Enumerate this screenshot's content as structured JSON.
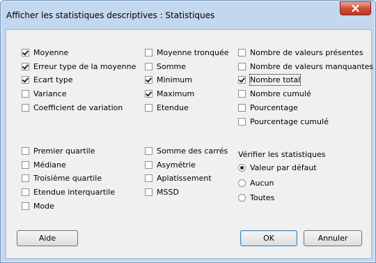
{
  "window": {
    "title": "Afficher les statistiques descriptives : Statistiques"
  },
  "icons": {
    "close": "close-x-icon"
  },
  "col1": [
    {
      "label": "Moyenne",
      "checked": true
    },
    {
      "label": "Erreur type de la moyenne",
      "checked": true
    },
    {
      "label": "Ecart type",
      "checked": true
    },
    {
      "label": "Variance",
      "checked": false
    },
    {
      "label": "Coefficient de variation",
      "checked": false
    }
  ],
  "col2": [
    {
      "label": "Moyenne tronquée",
      "checked": false
    },
    {
      "label": "Somme",
      "checked": false
    },
    {
      "label": "Minimum",
      "checked": true
    },
    {
      "label": "Maximum",
      "checked": true
    },
    {
      "label": "Etendue",
      "checked": false
    }
  ],
  "col3": [
    {
      "label": "Nombre de valeurs présentes",
      "checked": false
    },
    {
      "label": "Nombre de valeurs manquantes",
      "checked": false
    },
    {
      "label": "Nombre total",
      "checked": true
    },
    {
      "label": "Nombre cumulé",
      "checked": false
    },
    {
      "label": "Pourcentage",
      "checked": false
    },
    {
      "label": "Pourcentage cumulé",
      "checked": false
    }
  ],
  "col1b": [
    {
      "label": "Premier quartile",
      "checked": false
    },
    {
      "label": "Médiane",
      "checked": false
    },
    {
      "label": "Troisième quartile",
      "checked": false
    },
    {
      "label": "Etendue interquartile",
      "checked": false
    },
    {
      "label": "Mode",
      "checked": false
    }
  ],
  "col2b": [
    {
      "label": "Somme des carrés",
      "checked": false
    },
    {
      "label": "Asymétrie",
      "checked": false
    },
    {
      "label": "Aplatissement",
      "checked": false
    },
    {
      "label": "MSSD",
      "checked": false
    }
  ],
  "verify": {
    "title": "Vérifier les statistiques",
    "options": [
      {
        "label": "Valeur par défaut",
        "selected": true
      },
      {
        "label": "Aucun",
        "selected": false
      },
      {
        "label": "Toutes",
        "selected": false
      }
    ]
  },
  "buttons": {
    "help": "Aide",
    "ok": "OK",
    "cancel": "Annuler"
  }
}
